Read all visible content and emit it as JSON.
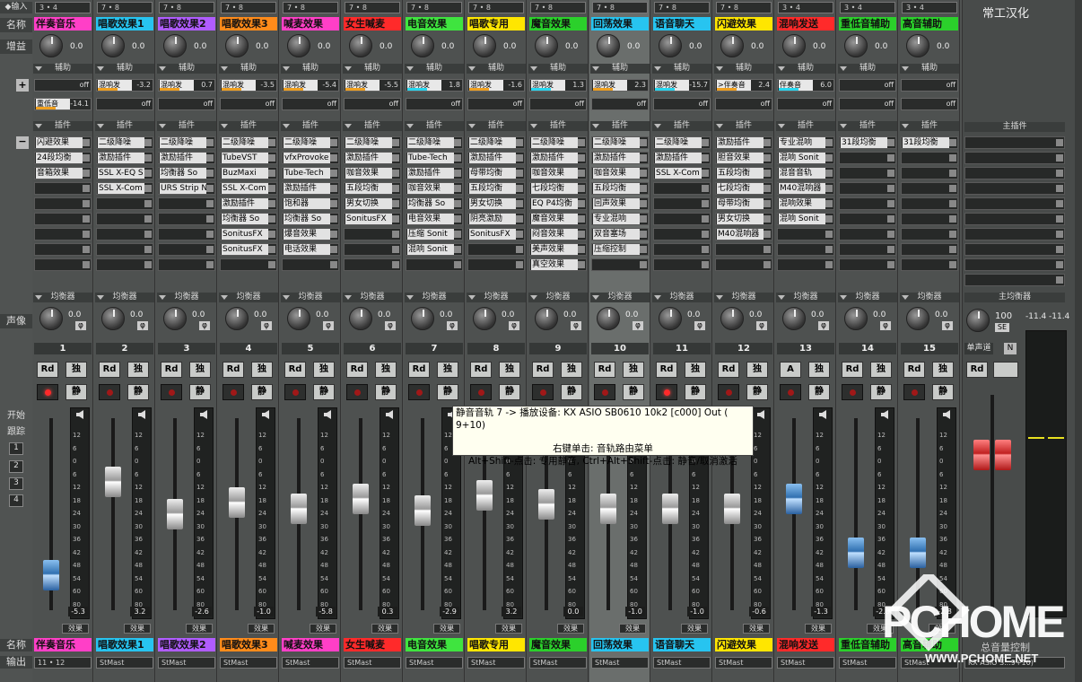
{
  "left": {
    "input": "◆输入",
    "name": "名称",
    "gain": "增益",
    "aux_plus": "+",
    "plugin_minus": "−",
    "pan": "声像",
    "start": "开始",
    "track": "跟踪",
    "nums": [
      "1",
      "2",
      "3",
      "4"
    ],
    "name2": "名称",
    "output": "输出"
  },
  "section": {
    "aux": "辅助",
    "plugin": "插件",
    "eq": "均衡器"
  },
  "btn": {
    "read": "Rd",
    "solo": "独",
    "mute": "静",
    "fx": "效果",
    "aux_off": "off",
    "pan_phi": "φ"
  },
  "tooltip": {
    "line1": "静音音轨 7 -> 播放设备: KX ASIO SB0610 10k2 [c000] Out ( 9+10)",
    "line2": "右键单击: 音轨路由菜单",
    "line3": "Alt+Shift-点击: 专用静音, Ctrl+Alt+Shift-点击: 静音/取消激活"
  },
  "master": {
    "title": "常工汉化",
    "plugin": "主插件",
    "eq": "主均衡器",
    "pan": "100",
    "se": "SE",
    "mono": "单声道",
    "n": "N",
    "read": "Rd",
    "meter_l": "-11.4",
    "meter_r": "-11.4",
    "name": "总音量控制",
    "out": "KX ASIO S...9+10)"
  },
  "channels": [
    {
      "n": "1",
      "input": "3 • 4",
      "name": "伴奏音乐",
      "color": "#ff3fc7",
      "gain": "0.0",
      "aux": [
        {
          "name": "",
          "value": "off"
        },
        {
          "name": "重低音",
          "value": "-14.1",
          "bar": "#f0a020"
        }
      ],
      "plugins": [
        "闪避效果",
        "24段均衡",
        "音箱效果",
        "",
        "",
        "",
        "",
        ""
      ],
      "pan": "0.0",
      "fader": "-5.3",
      "fader_pos": 0.18,
      "rec_on": true,
      "read": "Rd",
      "out": "11 • 12"
    },
    {
      "n": "2",
      "input": "7 • 8",
      "name": "唱歌效果1",
      "color": "#27c4f0",
      "gain": "0.0",
      "aux": [
        {
          "name": "混响发",
          "value": "-3.2",
          "bar": "#f0a020"
        },
        {
          "name": "",
          "value": "off"
        }
      ],
      "plugins": [
        "二级降噪",
        "激励插件",
        "SSL X-EQ S",
        "SSL X-Com",
        "",
        "",
        "",
        ""
      ],
      "pan": "0.0",
      "fader": "3.2",
      "fader_pos": 0.67,
      "rec_on": false,
      "read": "Rd",
      "out": "StMast"
    },
    {
      "n": "3",
      "input": "7 • 8",
      "name": "唱歌效果2",
      "color": "#b05cff",
      "gain": "0.0",
      "aux": [
        {
          "name": "混响发",
          "value": "0.7",
          "bar": "#f0a020"
        },
        {
          "name": "",
          "value": "off"
        }
      ],
      "plugins": [
        "二级降噪",
        "激励插件",
        "均衡器 So",
        "URS Strip N",
        "",
        "",
        "",
        ""
      ],
      "pan": "0.0",
      "fader": "-2.6",
      "fader_pos": 0.5,
      "rec_on": false,
      "read": "Rd",
      "out": "StMast"
    },
    {
      "n": "4",
      "input": "7 • 8",
      "name": "唱歌效果3",
      "color": "#ff8b1a",
      "gain": "0.0",
      "aux": [
        {
          "name": "混响发",
          "value": "-3.5",
          "bar": "#f0a020"
        },
        {
          "name": "",
          "value": "off"
        }
      ],
      "plugins": [
        "二级降噪",
        "TubeVST",
        "BuzMaxi",
        "SSL X-Com",
        "激励插件",
        "均衡器 So",
        "SonitusFX",
        "SonitusFX"
      ],
      "pan": "0.0",
      "fader": "-1.0",
      "fader_pos": 0.56,
      "rec_on": false,
      "read": "Rd",
      "out": "StMast"
    },
    {
      "n": "5",
      "input": "7 • 8",
      "name": "喊麦效果",
      "color": "#ff3fc7",
      "gain": "0.0",
      "aux": [
        {
          "name": "混响发",
          "value": "-5.4",
          "bar": "#f0a020"
        },
        {
          "name": "",
          "value": "off"
        }
      ],
      "plugins": [
        "二级降噪",
        "vfxProvoke",
        "Tube-Tech",
        "激励插件",
        "饱和器",
        "均衡器 So",
        "爆音效果",
        "电话效果"
      ],
      "pan": "0.0",
      "fader": "-5.8",
      "fader_pos": 0.53,
      "rec_on": false,
      "read": "Rd",
      "out": "StMast"
    },
    {
      "n": "6",
      "input": "7 • 8",
      "name": "女生喊麦",
      "color": "#ff2a2a",
      "gain": "0.0",
      "aux": [
        {
          "name": "混响发",
          "value": "-5.5",
          "bar": "#f0a020"
        },
        {
          "name": "",
          "value": "off"
        }
      ],
      "plugins": [
        "二级降噪",
        "激励插件",
        "咖音效果",
        "五段均衡",
        "男女切换",
        "SonitusFX",
        "",
        ""
      ],
      "pan": "0.0",
      "fader": "0.3",
      "fader_pos": 0.58,
      "rec_on": false,
      "read": "Rd",
      "out": "StMast"
    },
    {
      "n": "7",
      "input": "7 • 8",
      "name": "电音效果",
      "color": "#3fe43f",
      "gain": "0.0",
      "aux": [
        {
          "name": "混响发",
          "value": "1.8",
          "bar": "#27d7f0"
        },
        {
          "name": "",
          "value": "off"
        }
      ],
      "plugins": [
        "二级降噪",
        "Tube-Tech",
        "激励插件",
        "咖音效果",
        "均衡器 So",
        "电音效果",
        "压缩 Sonit",
        "混响 Sonit"
      ],
      "pan": "0.0",
      "fader": "-2.9",
      "fader_pos": 0.52,
      "rec_on": false,
      "read": "Rd",
      "out": "StMast"
    },
    {
      "n": "8",
      "input": "7 • 8",
      "name": "唱歌专用",
      "color": "#ffe600",
      "gain": "0.0",
      "aux": [
        {
          "name": "混响发",
          "value": "-1.6",
          "bar": "#f0a020"
        },
        {
          "name": "",
          "value": "off"
        }
      ],
      "plugins": [
        "二级降噪",
        "激励插件",
        "母带均衡",
        "五段均衡",
        "男女切换",
        "阴亮激励",
        "SonitusFX",
        ""
      ],
      "pan": "0.0",
      "fader": "3.2",
      "fader_pos": 0.6,
      "rec_on": false,
      "read": "Rd",
      "out": "StMast"
    },
    {
      "n": "9",
      "input": "7 • 8",
      "name": "魔音效果",
      "color": "#2bd02b",
      "gain": "0.0",
      "aux": [
        {
          "name": "混响发",
          "value": "1.3",
          "bar": "#27d7f0"
        },
        {
          "name": "",
          "value": "off"
        }
      ],
      "plugins": [
        "二级降噪",
        "激励插件",
        "咖音效果",
        "七段均衡",
        "EQ P4均衡",
        "魔音效果",
        "闷音效果",
        "美声效果",
        "真空效果",
        "频谱仪"
      ],
      "pan": "0.0",
      "fader": "0.0",
      "fader_pos": 0.55,
      "rec_on": false,
      "read": "Rd",
      "out": "StMast"
    },
    {
      "n": "10",
      "input": "7 • 8",
      "name": "回荡效果",
      "color": "#27c4f0",
      "gain": "0.0",
      "aux": [
        {
          "name": "混响发",
          "value": "2.3",
          "bar": "#f0a020"
        },
        {
          "name": "",
          "value": "off"
        }
      ],
      "plugins": [
        "二级降噪",
        "激励插件",
        "咖音效果",
        "五段均衡",
        "回声效果",
        "专业混响",
        "双音塞场",
        "压缩控制"
      ],
      "pan": "0.0",
      "fader": "-1.0",
      "fader_pos": 0.53,
      "rec_on": false,
      "read": "Rd",
      "out": "StMast",
      "selected": true
    },
    {
      "n": "11",
      "input": "7 • 8",
      "name": "语音聊天",
      "color": "#27c4f0",
      "gain": "0.0",
      "aux": [
        {
          "name": "混响发",
          "value": "-15.7",
          "bar": "#27d7f0"
        },
        {
          "name": "",
          "value": "off"
        }
      ],
      "plugins": [
        "二级降噪",
        "激励插件",
        "SSL X-Com",
        "",
        "",
        "",
        "",
        ""
      ],
      "pan": "0.0",
      "fader": "-1.0",
      "fader_pos": 0.53,
      "rec_on": true,
      "read": "Rd",
      "out": "StMast"
    },
    {
      "n": "12",
      "input": "7 • 8",
      "name": "闪避效果",
      "color": "#ffe600",
      "gain": "0.0",
      "aux": [
        {
          "name": ">伴奏音",
          "value": "2.4",
          "bar": "#f0a020"
        },
        {
          "name": "",
          "value": "off"
        }
      ],
      "plugins": [
        "激励插件",
        "胆音效果",
        "五段均衡",
        "七段均衡",
        "母带均衡",
        "男女切换",
        "M40混响器",
        ""
      ],
      "pan": "0.0",
      "fader": "-0.6",
      "fader_pos": 0.53,
      "rec_on": false,
      "read": "Rd",
      "out": "StMast"
    },
    {
      "n": "13",
      "input": "3 • 4",
      "name": "混响发送",
      "color": "#ff2a2a",
      "gain": "0.0",
      "aux": [
        {
          "name": "伴奏音",
          "value": "6.0",
          "bar": "#27d7f0"
        },
        {
          "name": "",
          "value": "off"
        }
      ],
      "plugins": [
        "专业混响",
        "混响 Sonit",
        "混音音轨",
        "M40混响器",
        "混响效果",
        "混响 Sonit",
        "",
        ""
      ],
      "pan": "0.0",
      "fader": "-1.3",
      "fader_pos": 0.58,
      "rec_on": false,
      "read": "A",
      "out": "StMast"
    },
    {
      "n": "14",
      "input": "3 • 4",
      "name": "重低音辅助",
      "color": "#2bd02b",
      "gain": "0.0",
      "aux": [
        {
          "name": "",
          "value": "off"
        },
        {
          "name": "",
          "value": "off"
        }
      ],
      "plugins": [
        "31段均衡",
        "",
        "",
        "",
        "",
        "",
        "",
        ""
      ],
      "pan": "0.0",
      "fader": "-2.8",
      "fader_pos": 0.3,
      "rec_on": false,
      "read": "Rd",
      "out": "StMast"
    },
    {
      "n": "15",
      "input": "3 • 4",
      "name": "高音辅助",
      "color": "#2bd02b",
      "gain": "0.0",
      "aux": [
        {
          "name": "",
          "value": "off"
        },
        {
          "name": "",
          "value": "off"
        }
      ],
      "plugins": [
        "31段均衡",
        "",
        "",
        "",
        "",
        "",
        "",
        ""
      ],
      "pan": "0.0",
      "fader": "-2.8",
      "fader_pos": 0.3,
      "rec_on": false,
      "read": "Rd",
      "out": "StMast"
    }
  ],
  "meter_scale": [
    "12",
    "6",
    "0",
    "6",
    "12",
    "18",
    "24",
    "30",
    "36",
    "42",
    "48",
    "54",
    "60",
    "80"
  ],
  "watermark": {
    "brand": "PCHOME",
    "url": "WWW.PCHOME.NET"
  }
}
